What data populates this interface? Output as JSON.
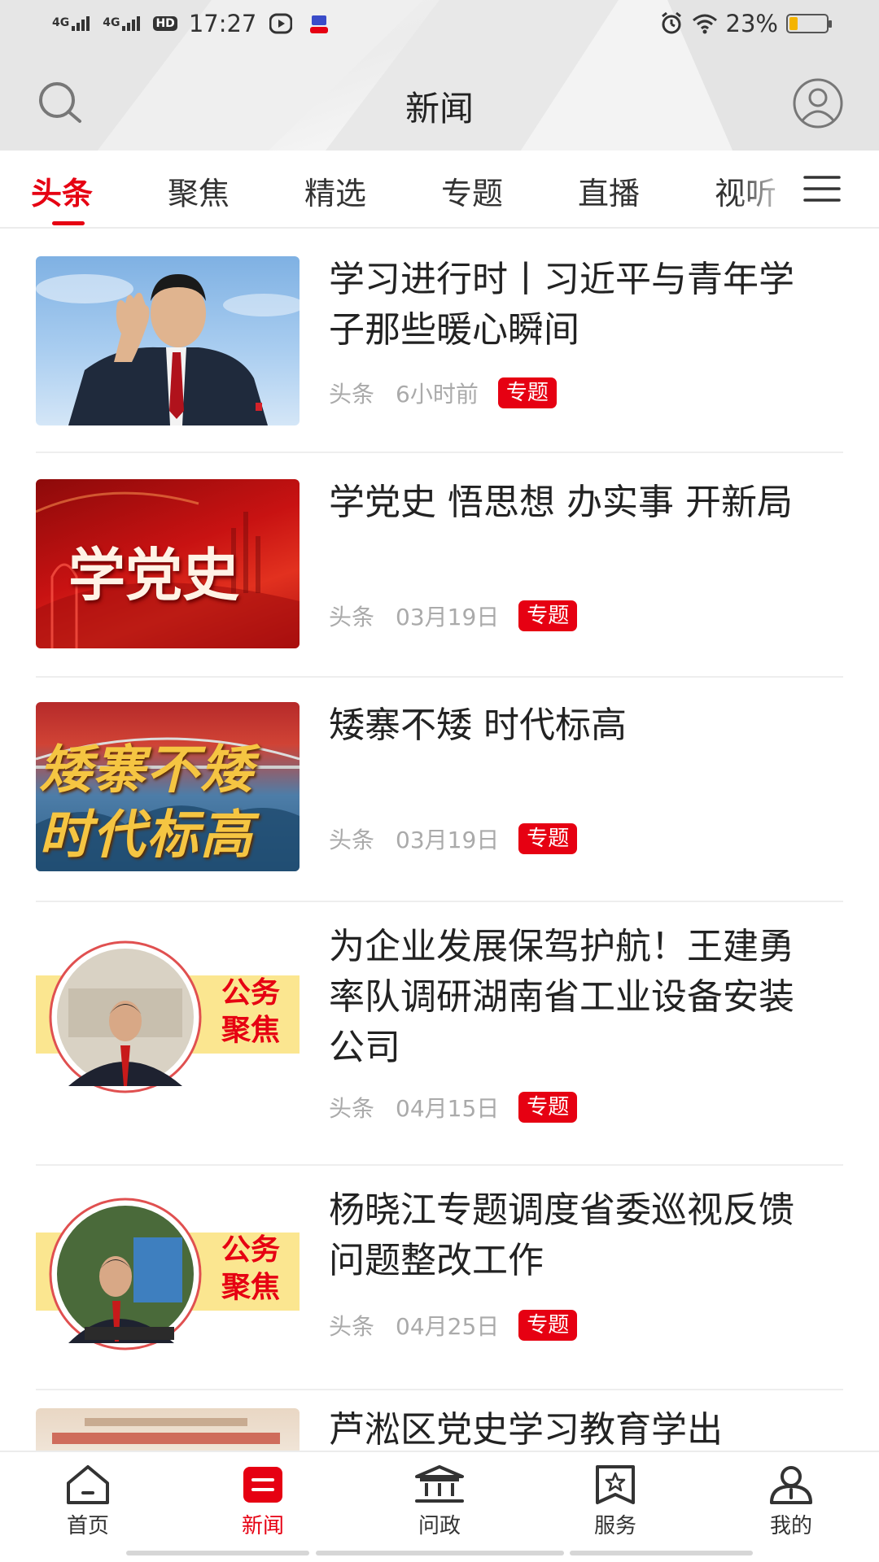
{
  "status_bar": {
    "network_1": "4G",
    "network_2": "4G",
    "hd": "HD",
    "time": "17:27",
    "battery": "23%",
    "battery_level": 0.23
  },
  "header": {
    "title": "新闻"
  },
  "tabs": [
    {
      "label": "头条",
      "active": true
    },
    {
      "label": "聚焦"
    },
    {
      "label": "精选"
    },
    {
      "label": "专题"
    },
    {
      "label": "直播"
    },
    {
      "label": "视听"
    }
  ],
  "news": [
    {
      "title": "学习进行时丨习近平与青年学子那些暖心瞬间",
      "source": "头条",
      "time": "6小时前",
      "badge": "专题"
    },
    {
      "title": "学党史 悟思想 办实事 开新局",
      "source": "头条",
      "time": "03月19日",
      "badge": "专题",
      "thumb_text": "学党史"
    },
    {
      "title": "矮寨不矮  时代标高",
      "source": "头条",
      "time": "03月19日",
      "badge": "专题",
      "thumb_text_1": "矮寨不矮",
      "thumb_text_2": "时代标高"
    },
    {
      "title": "为企业发展保驾护航！王建勇率队调研湖南省工业设备安装公司",
      "source": "头条",
      "time": "04月15日",
      "badge": "专题",
      "thumb_text_1": "公务",
      "thumb_text_2": "聚焦"
    },
    {
      "title": "杨晓江专题调度省委巡视反馈问题整改工作",
      "source": "头条",
      "time": "04月25日",
      "badge": "专题",
      "thumb_text_1": "公务",
      "thumb_text_2": "聚焦"
    },
    {
      "title": "芦淞区党史学习教育学出"
    }
  ],
  "bottom_nav": [
    {
      "label": "首页",
      "icon": "home-icon"
    },
    {
      "label": "新闻",
      "icon": "news-icon",
      "active": true
    },
    {
      "label": "问政",
      "icon": "government-icon"
    },
    {
      "label": "服务",
      "icon": "service-star-icon"
    },
    {
      "label": "我的",
      "icon": "profile-icon"
    }
  ],
  "colors": {
    "accent": "#e60012",
    "meta_text": "#aaaaaa",
    "divider": "#eeeeee"
  }
}
